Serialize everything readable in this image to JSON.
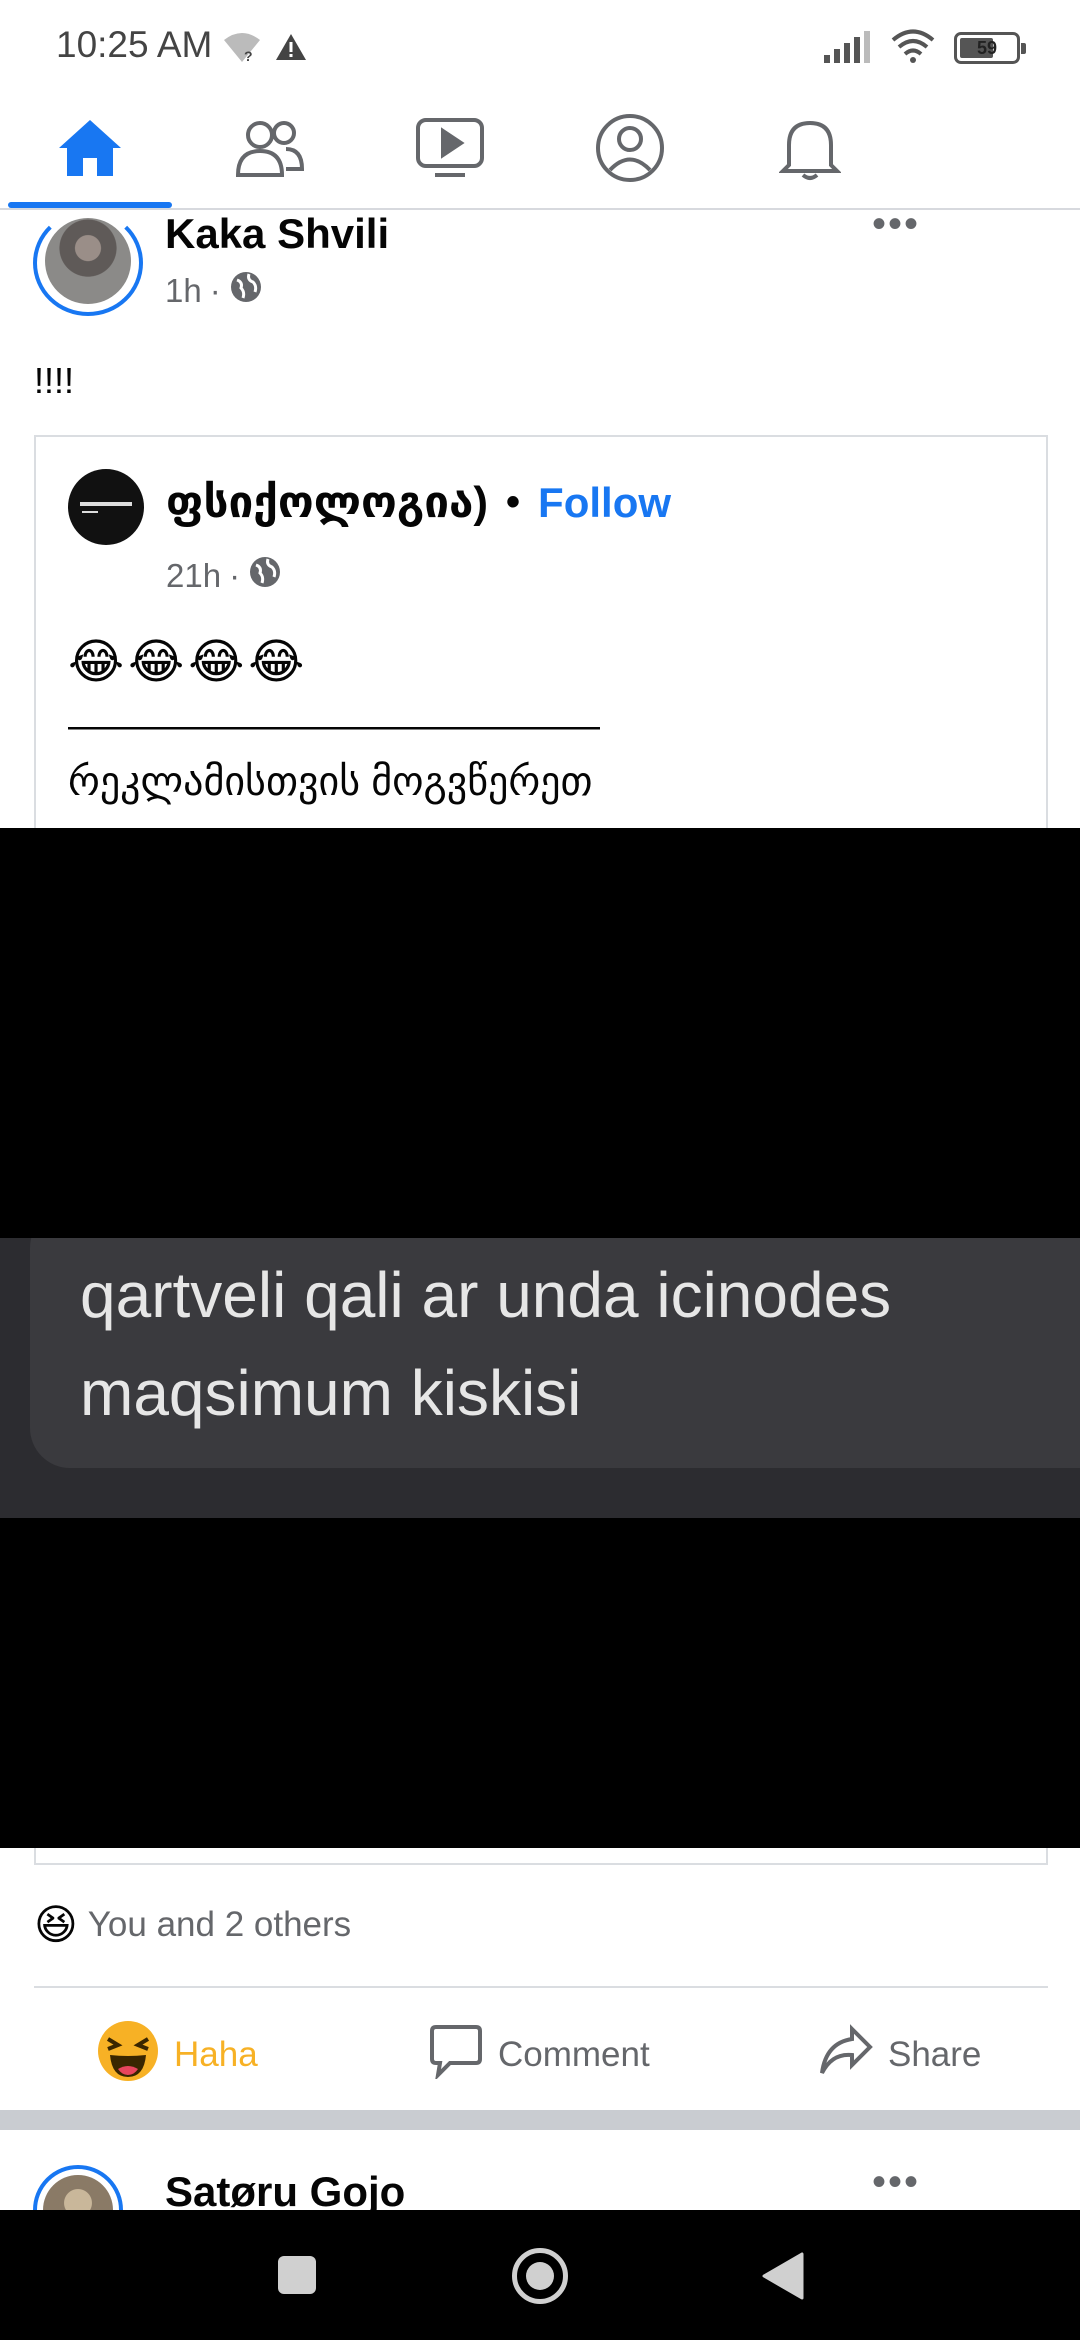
{
  "status_bar": {
    "time": "10:25 AM",
    "battery_level": "59"
  },
  "top_nav": {
    "tabs": [
      {
        "icon": "home-icon",
        "active": true
      },
      {
        "icon": "friends-icon",
        "active": false
      },
      {
        "icon": "video-icon",
        "active": false
      },
      {
        "icon": "profile-icon",
        "active": false
      },
      {
        "icon": "notifications-icon",
        "active": false
      }
    ],
    "accent_color": "#1877f2"
  },
  "post": {
    "author": "Kaka Shvili",
    "time": "1h",
    "privacy_icon": "globe-icon",
    "text": "!!!!",
    "shared": {
      "page_name": "ფსიქოლოგია)",
      "separator": "•",
      "follow_label": "Follow",
      "time": "21h",
      "emojis": [
        "😂",
        "😂",
        "😂",
        "😂"
      ],
      "dash_line": "——————————————",
      "caption": "რეკლამისთვის მოგვწერეთ",
      "media": {
        "line1": "qartveli qali ar unda icinodes",
        "line2": "maqsimum kiskisi"
      }
    },
    "reactions": {
      "emoji": "😆",
      "text": "You and 2 others"
    },
    "actions": {
      "haha": "Haha",
      "comment": "Comment",
      "share": "Share"
    }
  },
  "next_post": {
    "author": "Satøru Gojo"
  }
}
